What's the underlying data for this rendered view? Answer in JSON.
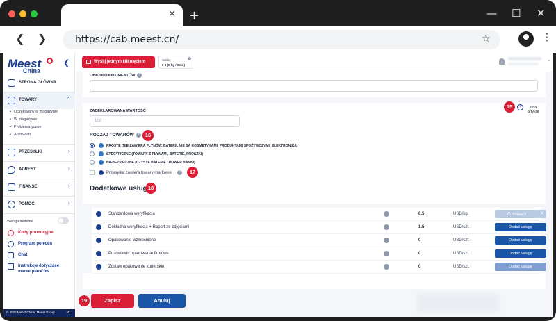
{
  "browser": {
    "url": "https://cab.meest.cn/",
    "new_tab_glyph": "+",
    "tab_close_glyph": "✕",
    "min_glyph": "—",
    "max_glyph": "☐",
    "close_glyph": "✕",
    "back_glyph": "❮",
    "forward_glyph": "❯",
    "star_glyph": "☆",
    "menu_glyph": "⋮"
  },
  "logo": {
    "main": "Meest",
    "sub": "China"
  },
  "sidebar": {
    "collapse_glyph": "❮",
    "items": [
      {
        "label": "STRONA GŁÓWNA",
        "icon": "grid-icon"
      },
      {
        "label": "TOWARY",
        "icon": "box-icon",
        "chevron": "⌃"
      },
      {
        "label": "PRZESYŁKI",
        "icon": "package-icon",
        "chevron": "›"
      },
      {
        "label": "ADRESY",
        "icon": "location-pin-icon",
        "chevron": "›"
      },
      {
        "label": "FINANSE",
        "icon": "wallet-icon",
        "chevron": "›"
      },
      {
        "label": "POMOC",
        "icon": "chat-bubble-icon",
        "chevron": "›"
      }
    ],
    "subitems": [
      "Oczekiwany w magazynie",
      "W magazynie",
      "Problematyczne",
      "Archiwum"
    ],
    "mobile_label": "Wersja mobilna",
    "links": [
      {
        "label": "Kody promocyjne",
        "icon": "percent-icon",
        "color": "#d91e36"
      },
      {
        "label": "Program poleceń",
        "icon": "people-icon",
        "color": "#1a3d8f"
      },
      {
        "label": "Chat",
        "icon": "chat-icon",
        "color": "#1a3d8f"
      },
      {
        "label": "Instrukcje dotyczące",
        "label2": "marketplace'ów",
        "icon": "document-icon",
        "color": "#1a3d8f"
      }
    ],
    "footer_copy": "© 2025 Meest China, Meest Group",
    "footer_lang": "PL"
  },
  "appbar": {
    "send_label": "Wyślij jednym kliknięciem",
    "saldo_title": "Saldo:",
    "saldo_value": "0 $ (0 kg / Cen.)",
    "q": "?",
    "user_chevron": "⌄"
  },
  "form": {
    "doc_link_label": "LINK DO DOKUMENTÓW",
    "declared_label": "ZADEKLAROWANA WARTOŚĆ",
    "declared_placeholder": "100",
    "add_article": "Dodaj artykuł",
    "goods_type_label": "RODZAJ TOWARÓW",
    "options": [
      "PROSTE (NIE ZAWIERA PŁYNÓW, BATERII, NIE SĄ KOSMETYKAMI, PRODUKTAMI SPOŻYWCZYMI, ELEKTRONIKĄ)",
      "SPECYFICZNE (TOWARY Z PŁYNAMI, BATERIE, PROSZKI)",
      "NIEBEZPIECZNE (CZYSTE BATERIE I POWER BANKI)"
    ],
    "branded_label": "Przesyłka zawiera towary markowe",
    "extra_heading": "Dodatkowe usługi"
  },
  "badges": {
    "b15": "15",
    "b16": "16",
    "b17": "17",
    "b18": "18",
    "b19": "19"
  },
  "services": [
    {
      "name": "Standardowa weryfikacja",
      "price": "0.5",
      "unit": "USD/kg.",
      "action": "W realizacji",
      "state": "pending"
    },
    {
      "name": "Dokładna weryfikacja + Raport ze zdjęciami",
      "price": "1.5",
      "unit": "USD/szt.",
      "action": "Dodać usługę",
      "state": "add"
    },
    {
      "name": "Opakowanie wzmocnione",
      "price": "0",
      "unit": "USD/szt.",
      "action": "Dodać usługę",
      "state": "add"
    },
    {
      "name": "Pozostawić opakowanie firmowe",
      "price": "0",
      "unit": "USD/szt.",
      "action": "Dodać usługę",
      "state": "add"
    },
    {
      "name": "Zostaw opakowanie kurierskie",
      "price": "0",
      "unit": "USD/szt.",
      "action": "Dodać usługę",
      "state": "add"
    }
  ],
  "remove_glyph": "✕",
  "footer": {
    "save": "Zapisz",
    "cancel": "Anuluj"
  },
  "colors": {
    "brand_red": "#d91e36",
    "brand_blue": "#1a3d8f",
    "button_blue": "#1a56a8"
  }
}
